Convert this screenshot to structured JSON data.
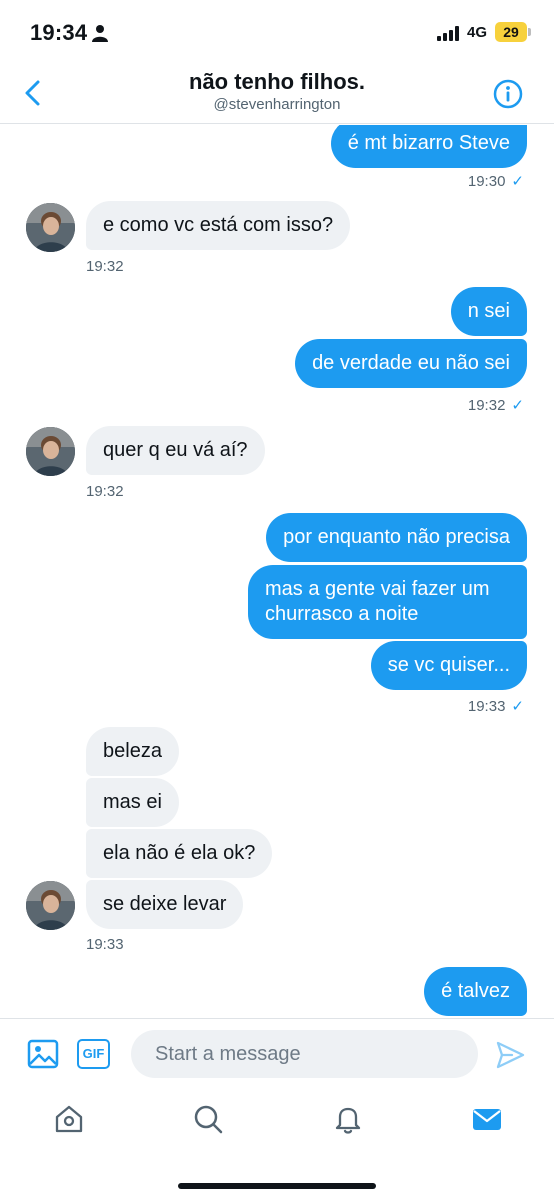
{
  "status_bar": {
    "time": "19:34",
    "network": "4G",
    "battery": "29"
  },
  "header": {
    "title": "não tenho filhos.",
    "handle": "@stevenharrington"
  },
  "messages": [
    {
      "sender": "me",
      "text": "é mt bizarro Steve"
    },
    {
      "sender": "me_time",
      "text": "19:30"
    },
    {
      "sender": "them",
      "text": "e como vc está com isso?"
    },
    {
      "sender": "them_time",
      "text": "19:32"
    },
    {
      "sender": "me",
      "text": "n sei"
    },
    {
      "sender": "me",
      "text": "de verdade eu não sei"
    },
    {
      "sender": "me_time",
      "text": "19:32"
    },
    {
      "sender": "them",
      "text": "quer q eu vá aí?"
    },
    {
      "sender": "them_time",
      "text": "19:32"
    },
    {
      "sender": "me",
      "text": "por enquanto não precisa"
    },
    {
      "sender": "me",
      "text": "mas a gente vai fazer um churrasco a noite"
    },
    {
      "sender": "me",
      "text": "se vc quiser..."
    },
    {
      "sender": "me_time",
      "text": "19:33"
    },
    {
      "sender": "them",
      "text": "beleza"
    },
    {
      "sender": "them",
      "text": "mas ei"
    },
    {
      "sender": "them",
      "text": "ela não é ela ok?"
    },
    {
      "sender": "them",
      "text": "se deixe levar"
    },
    {
      "sender": "them_time",
      "text": "19:33"
    },
    {
      "sender": "me",
      "text": "é talvez"
    }
  ],
  "composer": {
    "gif_label": "GIF",
    "placeholder": "Start a message"
  },
  "nav": {
    "items": [
      "home-icon",
      "search-icon",
      "notifications-icon",
      "messages-icon"
    ],
    "active": "messages-icon"
  },
  "colors": {
    "accent": "#1d9bf0",
    "incoming_bubble": "#eef1f4",
    "secondary_text": "#536471"
  }
}
